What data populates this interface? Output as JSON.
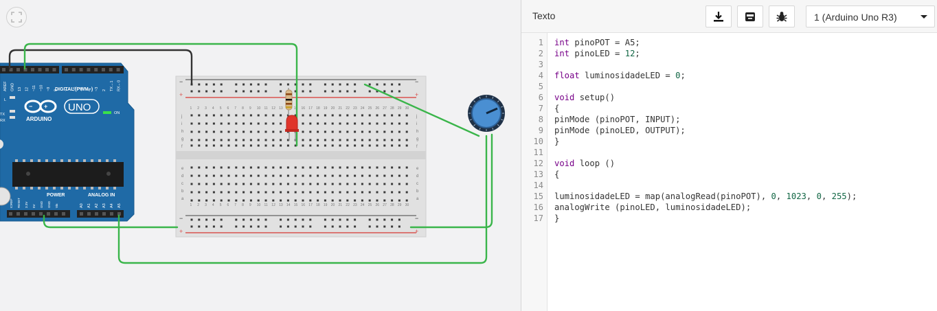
{
  "editor": {
    "title": "Texto",
    "board_select": "1 (Arduino Uno R3)",
    "buttons": [
      "download-icon",
      "library-icon",
      "debug-bug-icon"
    ],
    "lines": [
      {
        "n": "1",
        "parts": [
          [
            "kw",
            "int"
          ],
          [
            "t",
            " pinoPOT = A5;"
          ]
        ]
      },
      {
        "n": "2",
        "parts": [
          [
            "kw",
            "int"
          ],
          [
            "t",
            " pinoLED = "
          ],
          [
            "num",
            "12"
          ],
          [
            "t",
            ";"
          ]
        ]
      },
      {
        "n": "3",
        "parts": []
      },
      {
        "n": "4",
        "parts": [
          [
            "kw",
            "float"
          ],
          [
            "t",
            " luminosidadeLED = "
          ],
          [
            "num",
            "0"
          ],
          [
            "t",
            ";"
          ]
        ]
      },
      {
        "n": "5",
        "parts": []
      },
      {
        "n": "6",
        "parts": [
          [
            "kw",
            "void"
          ],
          [
            "t",
            " setup()"
          ]
        ]
      },
      {
        "n": "7",
        "parts": [
          [
            "t",
            "{"
          ]
        ]
      },
      {
        "n": "8",
        "parts": [
          [
            "t",
            "pinMode (pinoPOT, INPUT);"
          ]
        ]
      },
      {
        "n": "9",
        "parts": [
          [
            "t",
            "pinMode (pinoLED, OUTPUT);"
          ]
        ]
      },
      {
        "n": "10",
        "parts": [
          [
            "t",
            "}"
          ]
        ]
      },
      {
        "n": "11",
        "parts": []
      },
      {
        "n": "12",
        "parts": [
          [
            "kw",
            "void"
          ],
          [
            "t",
            " loop ()"
          ]
        ]
      },
      {
        "n": "13",
        "parts": [
          [
            "t",
            "{"
          ]
        ]
      },
      {
        "n": "14",
        "parts": []
      },
      {
        "n": "15",
        "parts": [
          [
            "t",
            "luminosidadeLED = map(analogRead(pinoPOT), "
          ],
          [
            "num",
            "0"
          ],
          [
            "t",
            ", "
          ],
          [
            "num",
            "1023"
          ],
          [
            "t",
            ", "
          ],
          [
            "num",
            "0"
          ],
          [
            "t",
            ", "
          ],
          [
            "num",
            "255"
          ],
          [
            "t",
            ");"
          ]
        ]
      },
      {
        "n": "16",
        "parts": [
          [
            "t",
            "analogWrite (pinoLED, luminosidadeLED);"
          ]
        ]
      },
      {
        "n": "17",
        "parts": [
          [
            "t",
            "}"
          ]
        ]
      }
    ]
  },
  "arduino": {
    "brand": "ARDUINO",
    "model": "UNO",
    "digital_label": "DIGITAL (PWM~)",
    "power_label": "POWER",
    "analog_label": "ANALOG IN",
    "on_label": "ON",
    "tx_label": "TX",
    "rx_label": "RX",
    "l_label": "L",
    "top_pins": [
      "AREF",
      "GND",
      "13",
      "12",
      "~11",
      "~10",
      "~9",
      "8",
      "7",
      "~6",
      "~5",
      "4",
      "~3",
      "2",
      "TX→1",
      "RX←0"
    ],
    "power_pins": [
      "IOREF",
      "RESET",
      "3.3V",
      "5V",
      "GND",
      "GND",
      "Vin"
    ],
    "analog_pins": [
      "A0",
      "A1",
      "A2",
      "A3",
      "A4",
      "A5"
    ]
  },
  "breadboard": {
    "row_letters_top": [
      "j",
      "i",
      "h",
      "g",
      "f"
    ],
    "row_letters_bottom": [
      "e",
      "d",
      "c",
      "b",
      "a"
    ],
    "columns": [
      "1",
      "2",
      "3",
      "4",
      "5",
      "6",
      "7",
      "8",
      "9",
      "10",
      "11",
      "12",
      "13",
      "14",
      "15",
      "16",
      "17",
      "18",
      "19",
      "20",
      "21",
      "22",
      "23",
      "24",
      "25",
      "26",
      "27",
      "28",
      "29",
      "30"
    ],
    "rail_minus": "−",
    "rail_plus": "+"
  },
  "colors": {
    "wire_green": "#3ab54a",
    "wire_black": "#333333",
    "arduino_blue": "#1f6aa6",
    "led_red": "#e0352b",
    "rail_red": "#d9534f"
  }
}
